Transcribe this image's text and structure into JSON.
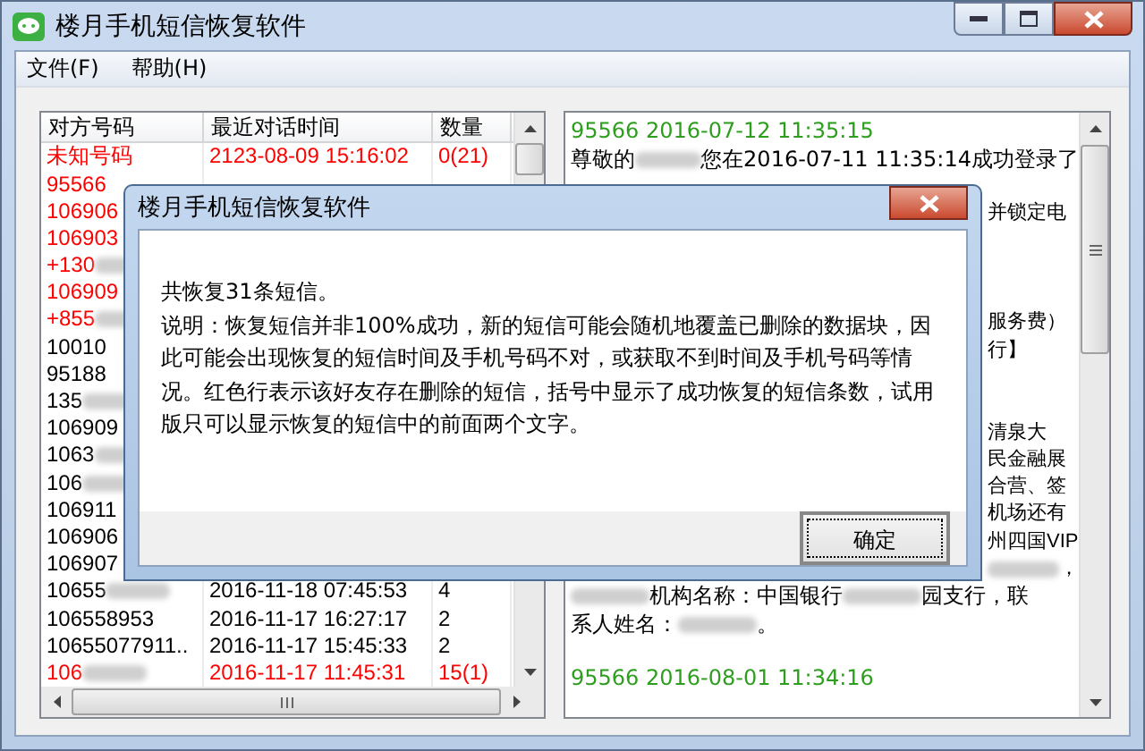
{
  "window": {
    "title": "楼月手机短信恢复软件"
  },
  "menu": [
    "文件(F)",
    "帮助(H)"
  ],
  "table": {
    "columns": [
      "对方号码",
      "最近对话时间",
      "数量"
    ],
    "rows": [
      {
        "number": "未知号码",
        "time": "2123-08-09 15:16:02",
        "count": "0(21)",
        "deleted": true,
        "blurred": false
      },
      {
        "number": "95566",
        "deleted": true,
        "blurred": false
      },
      {
        "number": "106906",
        "deleted": true,
        "blurred": false
      },
      {
        "number": "106903",
        "deleted": true,
        "blurred": false
      },
      {
        "number": "+130",
        "deleted": true,
        "blurred": true
      },
      {
        "number": "106909",
        "deleted": true,
        "blurred": false
      },
      {
        "number": "+855",
        "deleted": true,
        "blurred": true
      },
      {
        "number": "10010",
        "deleted": false,
        "blurred": false
      },
      {
        "number": "95188",
        "deleted": false,
        "blurred": false
      },
      {
        "number": "135",
        "deleted": false,
        "blurred": true
      },
      {
        "number": "106909",
        "deleted": false,
        "blurred": false
      },
      {
        "number": "1063",
        "deleted": false,
        "blurred": true
      },
      {
        "number": "106",
        "deleted": false,
        "blurred": true
      },
      {
        "number": "106911",
        "deleted": false,
        "blurred": false
      },
      {
        "number": "106906",
        "deleted": false,
        "blurred": false
      },
      {
        "number": "106907",
        "deleted": false,
        "blurred": false
      },
      {
        "number": "10655",
        "time": "2016-11-18 07:45:53",
        "count": "4",
        "deleted": false,
        "blurred": true
      },
      {
        "number": "106558953",
        "time": "2016-11-17 16:27:17",
        "count": "2",
        "deleted": false,
        "blurred": false
      },
      {
        "number": "10655077911..",
        "time": "2016-11-17 15:45:33",
        "count": "2",
        "deleted": false,
        "blurred": false
      },
      {
        "number": "106",
        "time": "2016-11-17 11:45:31",
        "count": "15(1)",
        "deleted": true,
        "blurred": true
      }
    ]
  },
  "messages": {
    "lines": [
      {
        "kind": "header",
        "segments": [
          "95566 2016-07-12 11:35:15"
        ]
      },
      {
        "kind": "text",
        "segments": [
          "尊敬的",
          {
            "kind": "blur"
          },
          "您在2016-07-11 11:35:14成功登录了"
        ]
      },
      {
        "kind": "gap"
      },
      {
        "kind": "tail",
        "segments": [
          "并锁定电"
        ]
      },
      {
        "kind": "gap"
      },
      {
        "kind": "gap"
      },
      {
        "kind": "gap"
      },
      {
        "kind": "tail",
        "segments": [
          "服务费）"
        ]
      },
      {
        "kind": "tail",
        "segments": [
          "行】"
        ]
      },
      {
        "kind": "gap"
      },
      {
        "kind": "gap"
      },
      {
        "kind": "tail",
        "segments": [
          "清泉大"
        ]
      },
      {
        "kind": "tail",
        "segments": [
          "民金融展"
        ]
      },
      {
        "kind": "tail",
        "segments": [
          "合营、签"
        ]
      },
      {
        "kind": "tail",
        "segments": [
          "机场还有"
        ]
      },
      {
        "kind": "tail",
        "segments": [
          "州四国VIP"
        ]
      },
      {
        "kind": "tail",
        "segments": [
          {
            "kind": "blur"
          },
          "，"
        ]
      },
      {
        "kind": "text",
        "segments": [
          {
            "kind": "blur"
          },
          "机构名称：中国银行",
          {
            "kind": "blur"
          },
          "园支行，联"
        ]
      },
      {
        "kind": "text",
        "segments": [
          "系人姓名：",
          {
            "kind": "blur"
          },
          "。"
        ]
      },
      {
        "kind": "gap"
      },
      {
        "kind": "header",
        "segments": [
          "95566 2016-08-01 11:34:16"
        ]
      }
    ]
  },
  "dialog": {
    "title": "楼月手机短信恢复软件",
    "summary": "共恢复31条短信。",
    "note": "说明：恢复短信并非100%成功，新的短信可能会随机地覆盖已删除的数据块，因此可能会出现恢复的短信时间及手机号码不对，或获取不到时间及手机号码等情况。红色行表示该好友存在删除的短信，括号中显示了成功恢复的短信条数，试用版只可以显示恢复的短信中的前面两个文字。",
    "button": "确定"
  }
}
